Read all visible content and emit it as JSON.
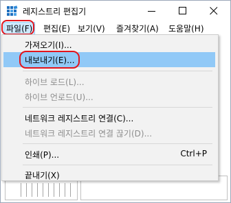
{
  "window": {
    "title": "레지스트리 편집기",
    "icon": "registry-editor-icon"
  },
  "menubar": {
    "file": "파일(F)",
    "edit": "편집(E)",
    "view": "보기(V)",
    "favorites": "즐겨찾기(A)",
    "help": "도움말(H)"
  },
  "file_menu": {
    "import": "가져오기(I)...",
    "export": "내보내기(E)...",
    "load_hive": "하이브 로드(L)...",
    "unload_hive": "하이브 언로드(U)...",
    "connect_network": "네트워크 레지스트리 연결(C)...",
    "disconnect_network": "네트워크 레지스트리 연결 끊기(D)...",
    "print": "인쇄(P)...",
    "print_shortcut": "Ctrl+P",
    "exit": "끝내기(X)"
  },
  "colors": {
    "highlight": "#91c9f7",
    "annotation_ring": "#e3141b",
    "menu_background": "#f2f2f2"
  }
}
